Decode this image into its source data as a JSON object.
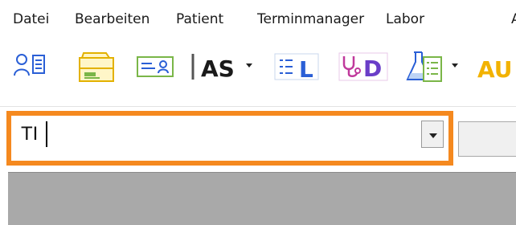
{
  "menubar": {
    "items": [
      {
        "label": "Datei"
      },
      {
        "label": "Bearbeiten"
      },
      {
        "label": "Patient"
      },
      {
        "label": "Terminmanager"
      },
      {
        "label": "Labor"
      },
      {
        "label": "A"
      }
    ]
  },
  "toolbar": {
    "buttons": [
      {
        "icon": "patient-card-icon"
      },
      {
        "icon": "file-cabinet-icon"
      },
      {
        "icon": "id-card-icon"
      },
      {
        "label": "AS",
        "icon": "as-icon"
      },
      {
        "label": "L",
        "icon": "list-l-icon"
      },
      {
        "label": "D",
        "icon": "stethoscope-d-icon"
      },
      {
        "icon": "lab-flask-icon"
      },
      {
        "label": "AU",
        "icon": "au-icon"
      }
    ]
  },
  "search_combo": {
    "value": "TI"
  },
  "colors": {
    "highlight": "#f5891f",
    "icon_blue": "#2a5fd6",
    "icon_green": "#7ab648",
    "icon_yellow": "#f2c200",
    "icon_purple": "#6a3ec8",
    "main_bg": "#a9a9a9"
  }
}
